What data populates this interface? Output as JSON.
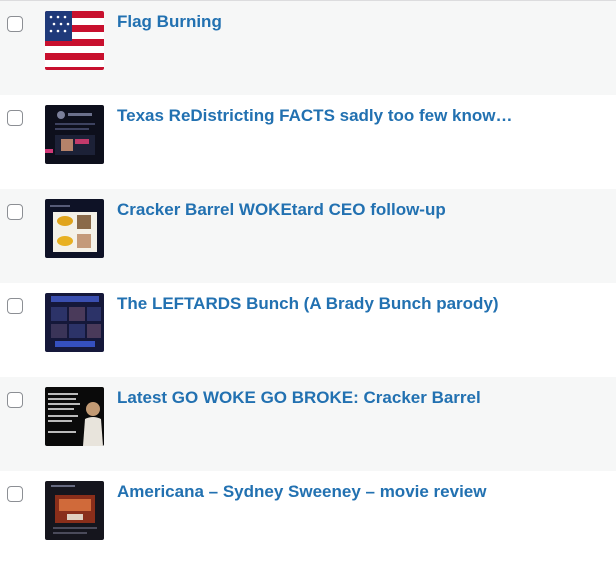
{
  "posts": [
    {
      "title": "Flag Burning",
      "thumbnail": "american-flag-thumbnail"
    },
    {
      "title": "Texas ReDistricting FACTS sadly too few know…",
      "thumbnail": "social-post-screenshot-thumbnail"
    },
    {
      "title": "Cracker Barrel WOKEtard CEO follow-up",
      "thumbnail": "cracker-barrel-screenshot-thumbnail"
    },
    {
      "title": "The LEFTARDS Bunch (A Brady Bunch parody)",
      "thumbnail": "leftards-bunch-thumbnail"
    },
    {
      "title": "Latest GO WOKE GO BROKE: Cracker Barrel",
      "thumbnail": "text-and-person-thumbnail"
    },
    {
      "title": "Americana – Sydney Sweeney – movie review",
      "thumbnail": "movie-page-thumbnail"
    }
  ],
  "colors": {
    "link": "#2271b1",
    "alt_row": "#f6f7f7",
    "border": "#dcdcde"
  }
}
